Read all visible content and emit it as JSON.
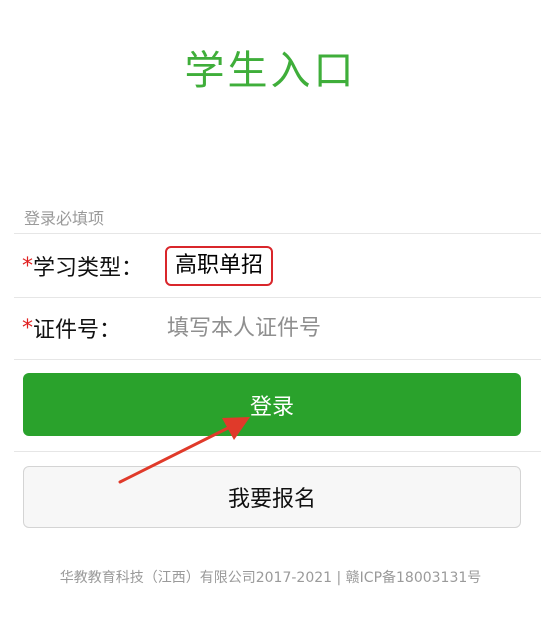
{
  "header": {
    "title": "学生入口"
  },
  "form": {
    "section_label": "登录必填项",
    "required_mark": "*",
    "type_field": {
      "label": "学习类型：",
      "value": "高职单招"
    },
    "id_field": {
      "label": "证件号：",
      "placeholder": "填写本人证件号",
      "value": ""
    }
  },
  "actions": {
    "login_label": "登录",
    "register_label": "我要报名"
  },
  "footer": {
    "text": "华教教育科技（江西）有限公司2017-2021 | 赣ICP备18003131号"
  },
  "colors": {
    "title": "#3fae3a",
    "login_button": "#2aa22c",
    "required": "#e02020",
    "highlight_box": "#d9262b",
    "arrow": "#e03a2a"
  }
}
